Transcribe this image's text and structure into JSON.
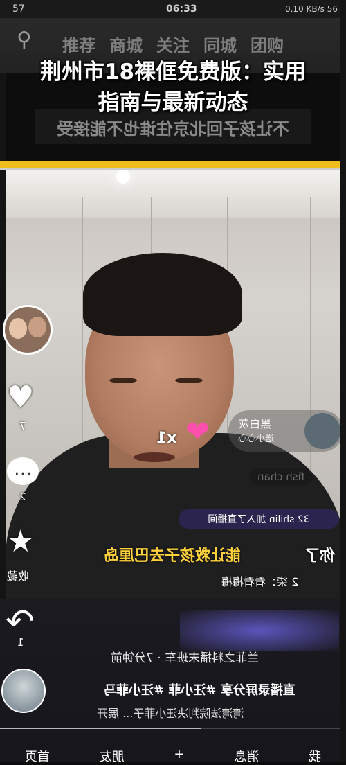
{
  "status_bar": {
    "left": "57",
    "time": "06:33",
    "right": "0.10 KB/s 56"
  },
  "top_nav": {
    "tabs": [
      "推荐",
      "商城",
      "关注",
      "同城",
      "团购"
    ]
  },
  "headline": {
    "line1": "荆州市18裸㑌免费版：实用",
    "line2": "指南与最新动态"
  },
  "mirrored_banner": "不让孩子回北京住谁也不能接受",
  "side_actions": {
    "like_count": "7",
    "comment_count": "2",
    "favorite_label": "收藏",
    "share_count": "1"
  },
  "live_chat": {
    "user_card_name": "黑白灰",
    "user_card_sub": "送小心心",
    "faded_user": "fish chan",
    "x_mark": "x1",
    "join_notice": "32 shilin 加入了直播间",
    "gold_message": "能让救孩子去巴厘岛",
    "gold_prefix": "你了",
    "chat_name": "2 柒：看看梅梅"
  },
  "post": {
    "time_line": "兰菲之料播末班车 · 7分钟前",
    "tags_line": "直播录屏分享 #汪小菲 #汪小菲马",
    "desc_line": "湾湾法院判决汪小菲子...  展开",
    "progress_percent": 58
  },
  "bottom_nav": {
    "items": [
      "我",
      "消息",
      "+",
      "朋友",
      "首页"
    ]
  },
  "colors": {
    "accent_yellow": "#f0be1b",
    "gold_text": "#ffd23c",
    "heart_pink": "#ff4fae"
  }
}
